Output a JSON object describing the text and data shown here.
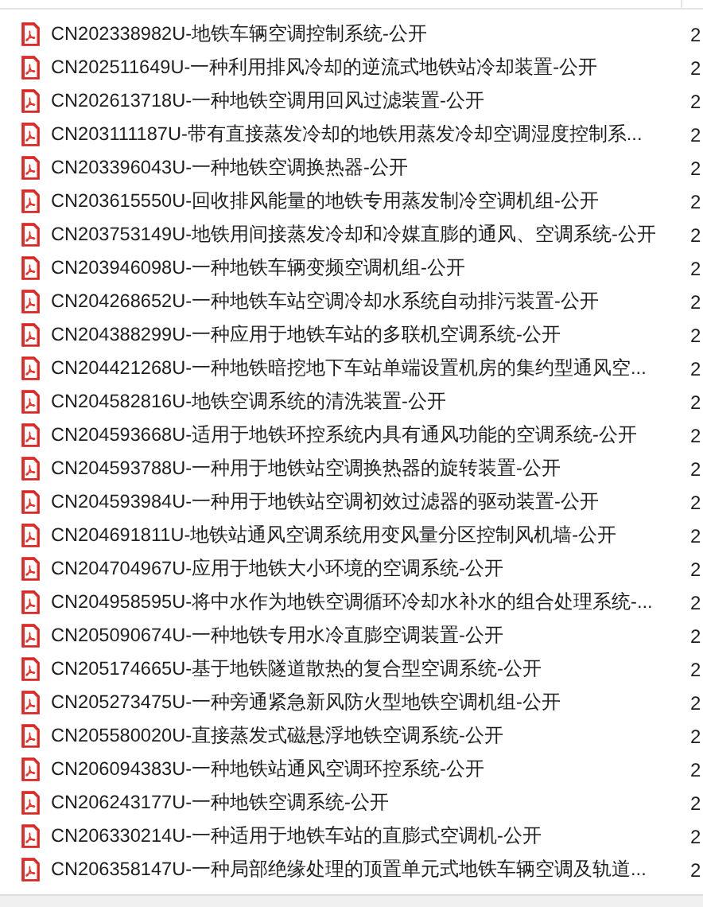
{
  "files": [
    {
      "name": "CN202338982U-地铁车辆空调控制系统-公开",
      "column_2": "2"
    },
    {
      "name": "CN202511649U-一种利用排风冷却的逆流式地铁站冷却装置-公开",
      "column_2": "2"
    },
    {
      "name": "CN202613718U-一种地铁空调用回风过滤装置-公开",
      "column_2": "2"
    },
    {
      "name": "CN203111187U-带有直接蒸发冷却的地铁用蒸发冷却空调湿度控制系...",
      "column_2": "2"
    },
    {
      "name": "CN203396043U-一种地铁空调换热器-公开",
      "column_2": "2"
    },
    {
      "name": "CN203615550U-回收排风能量的地铁专用蒸发制冷空调机组-公开",
      "column_2": "2"
    },
    {
      "name": "CN203753149U-地铁用间接蒸发冷却和冷媒直膨的通风、空调系统-公开",
      "column_2": "2"
    },
    {
      "name": "CN203946098U-一种地铁车辆变频空调机组-公开",
      "column_2": "2"
    },
    {
      "name": "CN204268652U-一种地铁车站空调冷却水系统自动排污装置-公开",
      "column_2": "2"
    },
    {
      "name": "CN204388299U-一种应用于地铁车站的多联机空调系统-公开",
      "column_2": "2"
    },
    {
      "name": "CN204421268U-一种地铁暗挖地下车站单端设置机房的集约型通风空...",
      "column_2": "2"
    },
    {
      "name": "CN204582816U-地铁空调系统的清洗装置-公开",
      "column_2": "2"
    },
    {
      "name": "CN204593668U-适用于地铁环控系统内具有通风功能的空调系统-公开",
      "column_2": "2"
    },
    {
      "name": "CN204593788U-一种用于地铁站空调换热器的旋转装置-公开",
      "column_2": "2"
    },
    {
      "name": "CN204593984U-一种用于地铁站空调初效过滤器的驱动装置-公开",
      "column_2": "2"
    },
    {
      "name": "CN204691811U-地铁站通风空调系统用变风量分区控制风机墙-公开",
      "column_2": "2"
    },
    {
      "name": "CN204704967U-应用于地铁大小环境的空调系统-公开",
      "column_2": "2"
    },
    {
      "name": "CN204958595U-将中水作为地铁空调循环冷却水补水的组合处理系统-...",
      "column_2": "2"
    },
    {
      "name": "CN205090674U-一种地铁专用水冷直膨空调装置-公开",
      "column_2": "2"
    },
    {
      "name": "CN205174665U-基于地铁隧道散热的复合型空调系统-公开",
      "column_2": "2"
    },
    {
      "name": "CN205273475U-一种旁通紧急新风防火型地铁空调机组-公开",
      "column_2": "2"
    },
    {
      "name": "CN205580020U-直接蒸发式磁悬浮地铁空调系统-公开",
      "column_2": "2"
    },
    {
      "name": "CN206094383U-一种地铁站通风空调环控系统-公开",
      "column_2": "2"
    },
    {
      "name": "CN206243177U-一种地铁空调系统-公开",
      "column_2": "2"
    },
    {
      "name": "CN206330214U-一种适用于地铁车站的直膨式空调机-公开",
      "column_2": "2"
    },
    {
      "name": "CN206358147U-一种局部绝缘处理的顶置单元式地铁车辆空调及轨道...",
      "column_2": "2"
    }
  ]
}
